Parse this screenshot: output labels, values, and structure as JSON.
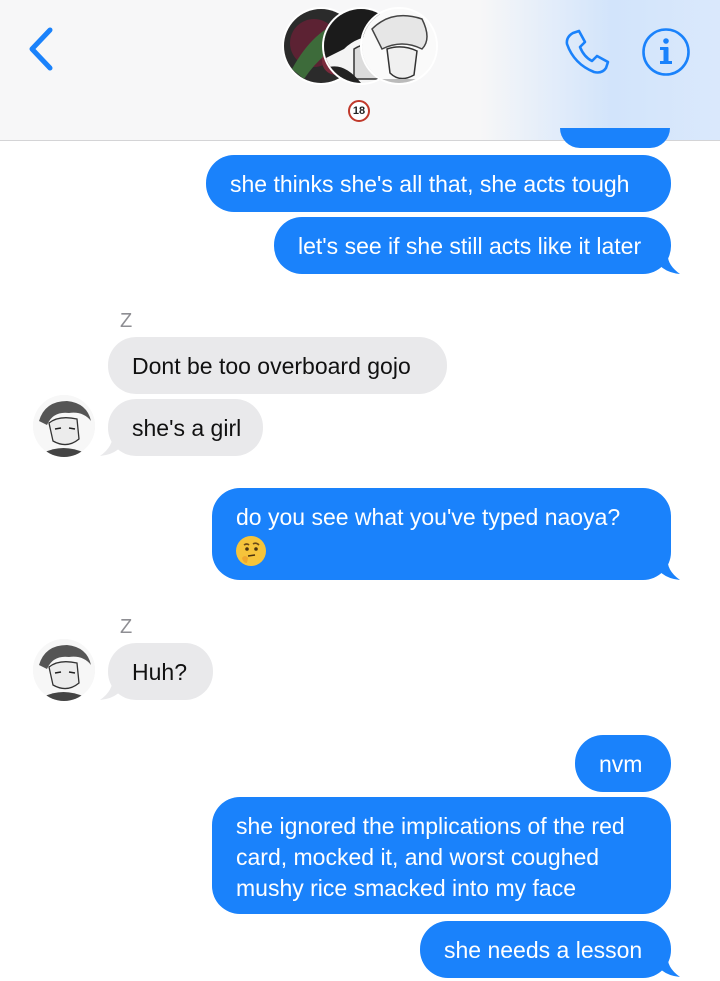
{
  "header": {
    "back_icon": "chevron-left-icon",
    "call_icon": "phone-icon",
    "info_icon": "info-icon",
    "rating_badge": "18",
    "accent_color": "#1a82fb"
  },
  "messages": [
    {
      "dir": "out",
      "text": "she thinks she's all that, she acts tough"
    },
    {
      "dir": "out",
      "text": "let's see if she still acts like it later"
    },
    {
      "dir": "in",
      "sender": "Z",
      "text": "Dont be too overboard gojo"
    },
    {
      "dir": "in",
      "text": "she's a girl"
    },
    {
      "dir": "out",
      "text": "do you see what you've typed naoya?",
      "emoji": "thinking-face-icon"
    },
    {
      "dir": "in",
      "sender": "Z",
      "text": "Huh?"
    },
    {
      "dir": "out",
      "text": "nvm"
    },
    {
      "dir": "out",
      "text": "she ignored the implications of the red card, mocked it, and worst coughed mushy rice smacked into my face"
    },
    {
      "dir": "out",
      "text": "she needs a lesson"
    }
  ]
}
